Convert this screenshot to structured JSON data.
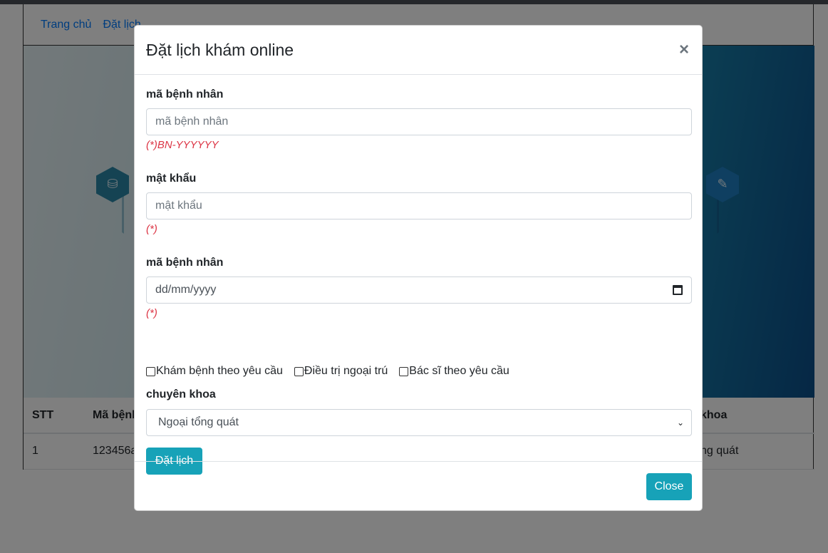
{
  "nav": {
    "home": "Trang chủ",
    "booking": "Đặt lịch"
  },
  "table": {
    "headers": [
      "STT",
      "Mã bệnh",
      "khoa"
    ],
    "row": [
      "1",
      "123456a",
      "ng quát"
    ]
  },
  "modal": {
    "title": "Đặt lịch khám online",
    "close_x": "×",
    "patient_id": {
      "label": "mã bệnh nhân",
      "placeholder": "mã bệnh nhân",
      "hint": "(*)BN-YYYYYY"
    },
    "password": {
      "label": "mật khẩu",
      "placeholder": "mật khẩu",
      "hint": "(*)"
    },
    "date": {
      "label": "mã bệnh nhân",
      "value": "dd/mm/yyyy",
      "hint": "(*)"
    },
    "checkboxes": [
      "Khám bệnh theo yêu cầu",
      "Điều trị ngoại trú",
      "Bác sĩ theo yêu cầu"
    ],
    "specialty": {
      "label": "chuyên khoa",
      "selected": "Ngoại tổng quát"
    },
    "submit": "Đặt lịch",
    "close_button": "Close"
  },
  "colors": {
    "accent": "#17a2b8",
    "error": "#dc3545",
    "link": "#007bff"
  }
}
